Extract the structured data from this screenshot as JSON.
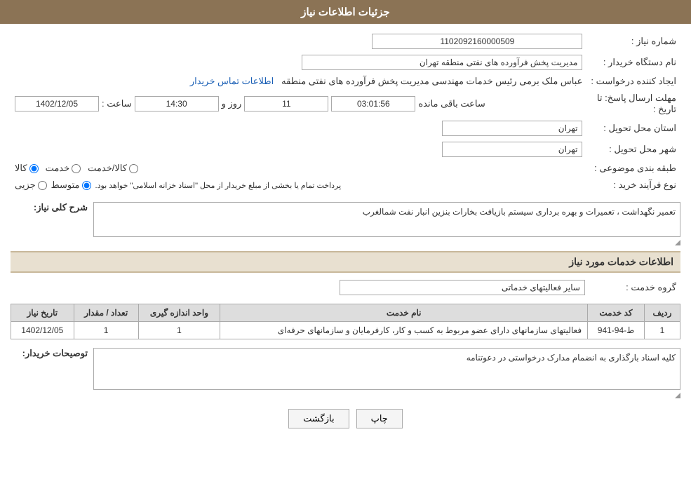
{
  "header": {
    "title": "جزئیات اطلاعات نیاز"
  },
  "fields": {
    "shomareNiaz_label": "شماره نیاز :",
    "shomareNiaz_value": "1102092160000509",
    "namDastgah_label": "نام دستگاه خریدار :",
    "namDastgah_value": "مدیریت پخش فرآورده های نفتی منطقه تهران",
    "ijadKonande_label": "ایجاد کننده درخواست :",
    "ijadKonande_value": "عباس ملک برمی رئیس خدمات مهندسی مدیریت پخش فرآورده های نفتی منطقه",
    "ijadKonande_link": "اطلاعات تماس خریدار",
    "mohlatErsal_label": "مهلت ارسال پاسخ: تا تاریخ :",
    "date_value": "1402/12/05",
    "time_label": "ساعت :",
    "time_value": "14:30",
    "roz_label": "روز و",
    "roz_value": "11",
    "saatBaqi_label": "ساعت باقی مانده",
    "saatBaqi_value": "03:01:56",
    "ostan_label": "استان محل تحویل :",
    "ostan_value": "تهران",
    "shahr_label": "شهر محل تحویل :",
    "shahr_value": "تهران",
    "tabaghe_label": "طبقه بندی موضوعی :",
    "tabaghe_options": [
      {
        "label": "کالا",
        "selected": true
      },
      {
        "label": "خدمت",
        "selected": false
      },
      {
        "label": "کالا/خدمت",
        "selected": false
      }
    ],
    "noeFarayand_label": "نوع فرآیند خرید :",
    "noeFarayand_options": [
      {
        "label": "جزیی",
        "selected": false
      },
      {
        "label": "متوسط",
        "selected": true
      },
      {
        "label": "",
        "selected": false
      }
    ],
    "noeFarayand_note": "پرداخت تمام یا بخشی از مبلغ خریدار از محل \"اسناد خزانه اسلامی\" خواهد بود.",
    "sharh_label": "شرح کلی نیاز:",
    "sharh_value": "تعمیر نگهداشت ، تعمیرات و بهره برداری سیستم بازیافت بخارات بنزین انبار نفت شمالغرب",
    "khadamat_label": "اطلاعات خدمات مورد نیاز",
    "group_label": "گروه خدمت :",
    "group_value": "سایر فعالیتهای خدماتی",
    "table": {
      "headers": [
        "ردیف",
        "کد خدمت",
        "نام خدمت",
        "واحد اندازه گیری",
        "تعداد / مقدار",
        "تاریخ نیاز"
      ],
      "rows": [
        {
          "radif": "1",
          "kod": "ط-94-941",
          "name": "فعالیتهای سازمانهای دارای عضو مربوط به کسب و کار، کارفرمایان و سازمانهای حرفه‌ای",
          "vahed": "1",
          "tedad": "1",
          "tarikh": "1402/12/05"
        }
      ]
    },
    "tawsiyat_label": "توصیحات خریدار:",
    "tawsiyat_value": "کلیه اسناد بارگذاری به انضمام مدارک درخواستی در دعوتنامه"
  },
  "buttons": {
    "print_label": "چاپ",
    "back_label": "بازگشت"
  }
}
